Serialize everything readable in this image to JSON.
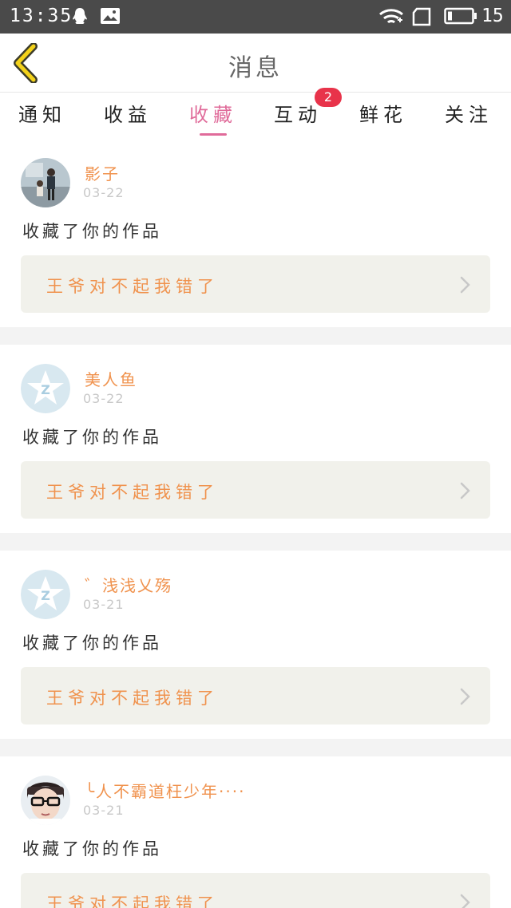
{
  "status_bar": {
    "time": "13:35",
    "battery": "15",
    "icons": [
      "qq-icon",
      "image-icon",
      "wifi-icon",
      "sim-icon",
      "battery-icon"
    ]
  },
  "header": {
    "title": "消息",
    "back_icon": "chevron-left-icon"
  },
  "tabs": [
    {
      "label": "通知"
    },
    {
      "label": "收益"
    },
    {
      "label": "收藏"
    },
    {
      "label": "互动",
      "badge": "2"
    },
    {
      "label": "鲜花"
    },
    {
      "label": "关注"
    }
  ],
  "active_tab": "收藏",
  "feed": [
    {
      "user": "影子",
      "date": "03-22",
      "action": "收藏了你的作品",
      "work": "王爷对不起我错了"
    },
    {
      "user": "美人鱼",
      "date": "03-22",
      "action": "收藏了你的作品",
      "work": "王爷对不起我错了"
    },
    {
      "user": "゛浅浅乂殇",
      "date": "03-21",
      "action": "收藏了你的作品",
      "work": "王爷对不起我错了"
    },
    {
      "user": "╰人不霸道枉少年····",
      "date": "03-21",
      "action": "收藏了你的作品",
      "work": "王爷对不起我错了"
    }
  ],
  "colors": {
    "accent": "#e06b9a",
    "username": "#f0924d",
    "badge": "#e8334a",
    "back_arrow": "#f3d21a",
    "status_bar": "#4a4a4a"
  }
}
